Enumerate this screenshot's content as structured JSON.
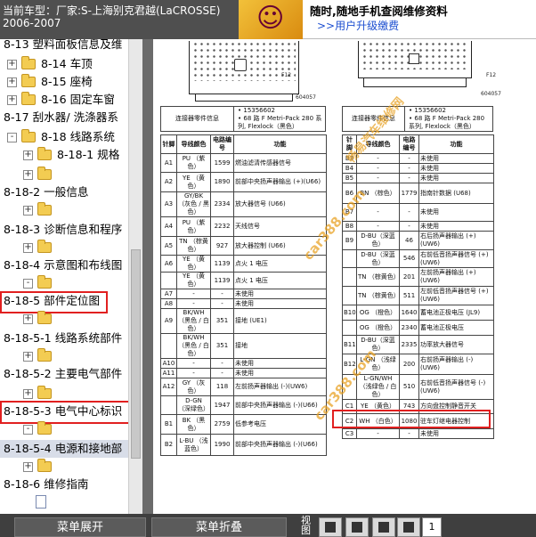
{
  "header": {
    "line1": "当前车型：厂家:S-上海别克君越(LaCROSSE)",
    "line2": "2006-2007"
  },
  "banner": {
    "line1": "随时,随地手机查阅维修资料",
    "line2": ">>用户升级缴费"
  },
  "tree": {
    "items": [
      {
        "label": "8-13 塑料面板信息及维",
        "expander": "",
        "icon": "none"
      },
      {
        "label": "8-14 车顶",
        "expander": "+",
        "icon": "folder"
      },
      {
        "label": "8-15 座椅",
        "expander": "+",
        "icon": "folder"
      },
      {
        "label": "8-16 固定车窗",
        "expander": "+",
        "icon": "folder"
      },
      {
        "label": "8-17 刮水器/ 洗涤器系",
        "expander": "",
        "icon": "none"
      },
      {
        "label": "8-18 线路系统",
        "expander": "-",
        "icon": "folder"
      },
      {
        "label": "8-18-1 规格",
        "expander": "+",
        "icon": "folder"
      },
      {
        "label": "",
        "expander": "+",
        "icon": "folder"
      },
      {
        "label": "8-18-2 一般信息",
        "expander": "",
        "icon": "none"
      },
      {
        "label": "",
        "expander": "+",
        "icon": "folder"
      },
      {
        "label": "8-18-3 诊断信息和程序",
        "expander": "",
        "icon": "none"
      },
      {
        "label": "",
        "expander": "+",
        "icon": "folder"
      },
      {
        "label": "8-18-4 示意图和布线图",
        "expander": "",
        "icon": "none"
      },
      {
        "label": "",
        "expander": "-",
        "icon": "folder"
      },
      {
        "label": "8-18-5 部件定位图",
        "expander": "",
        "icon": "none"
      },
      {
        "label": "",
        "expander": "+",
        "icon": "folder"
      },
      {
        "label": "8-18-5-1 线路系统部件",
        "expander": "",
        "icon": "none"
      },
      {
        "label": "",
        "expander": "+",
        "icon": "folder"
      },
      {
        "label": "8-18-5-2 主要电气部件",
        "expander": "",
        "icon": "none"
      },
      {
        "label": "",
        "expander": "+",
        "icon": "folder"
      },
      {
        "label": "8-18-5-3 电气中心标识",
        "expander": "",
        "icon": "none"
      },
      {
        "label": "",
        "expander": "-",
        "icon": "folder"
      },
      {
        "label": "8-18-5-4 电源和接地部",
        "expander": "",
        "icon": "none"
      },
      {
        "label": "",
        "expander": "+",
        "icon": "folder"
      },
      {
        "label": "8-18-6 维修指南",
        "expander": "",
        "icon": "none"
      },
      {
        "label": "",
        "expander": "",
        "icon": "doc"
      }
    ]
  },
  "document": {
    "left_connector": {
      "label": "F12",
      "code": "604057"
    },
    "right_connector": {
      "label": "F12",
      "code": "604057"
    },
    "left_info": {
      "title": "连接器零件信息",
      "lines": [
        "15356602",
        "68 路 F Metri-Pack 280 系列, Flexlock（黑色）"
      ]
    },
    "right_info": {
      "title": "连接器零件信息",
      "lines": [
        "15356602",
        "68 路 F Metri-Pack 280 系列, Flexlock（黑色）"
      ]
    },
    "left_table": {
      "headers": [
        "针脚",
        "导线颜色",
        "电路编号",
        "功能"
      ],
      "rows": [
        [
          "A1",
          "PU （紫色）",
          "1599",
          "燃油滤清传感器信号"
        ],
        [
          "A2",
          "YE （黄色）",
          "1890",
          "前部中央扬声器输出 (+)(U66)"
        ],
        [
          "A3",
          "GY/BK（灰色 / 黑色）",
          "2334",
          "放大器信号 (U66)"
        ],
        [
          "A4",
          "PU （紫色）",
          "2232",
          "天线信号"
        ],
        [
          "A5",
          "TN （棕黄色）",
          "927",
          "放大器控制 (U66)"
        ],
        [
          "A6",
          "YE （黄色）",
          "1139",
          "点火 1 电压"
        ],
        [
          "",
          "YE （黄色）",
          "1139",
          "点火 1 电压"
        ],
        [
          "A7",
          "-",
          "-",
          "未使用"
        ],
        [
          "A8",
          "-",
          "-",
          "未使用"
        ],
        [
          "A9",
          "BK/WH（黑色 / 白色）",
          "351",
          "接地 (UE1)"
        ],
        [
          "",
          "BK/WH（黑色 / 白色）",
          "351",
          "接地"
        ],
        [
          "A10",
          "-",
          "-",
          "未使用"
        ],
        [
          "A11",
          "-",
          "-",
          "未使用"
        ],
        [
          "A12",
          "GY （灰色）",
          "118",
          "左前扬声器输出 (-)(UW6)"
        ],
        [
          "",
          "D-GN （深绿色）",
          "1947",
          "前部中央扬声器输出 (-)(U66)"
        ],
        [
          "B1",
          "BK （黑色）",
          "2759",
          "低参考电压"
        ],
        [
          "B2",
          "L-BU （浅蓝色）",
          "1990",
          "前部中央扬声器输出 (-)(U66)"
        ]
      ]
    },
    "right_table": {
      "headers": [
        "针脚",
        "导线颜色",
        "电路编号",
        "功能"
      ],
      "rows": [
        [
          "B3",
          "-",
          "-",
          "未使用"
        ],
        [
          "B4",
          "-",
          "-",
          "未使用"
        ],
        [
          "B5",
          "-",
          "-",
          "未使用"
        ],
        [
          "B6",
          "BN （棕色）",
          "1779",
          "指南针数据 (U68)"
        ],
        [
          "B7",
          "-",
          "-",
          "未使用"
        ],
        [
          "B8",
          "-",
          "-",
          "未使用"
        ],
        [
          "B9",
          "D-BU（深蓝色）",
          "46",
          "右后扬声器输出 (+)(UW6)"
        ],
        [
          "",
          "D-BU（深蓝色）",
          "546",
          "右前低音扬声器信号 (+)(UW6)"
        ],
        [
          "",
          "TN （棕黄色）",
          "201",
          "左前扬声器输出 (+)(UW6)"
        ],
        [
          "",
          "TN （棕黄色）",
          "511",
          "左前低音扬声器信号 (+)(UW6)"
        ],
        [
          "B10",
          "OG （橙色）",
          "1640",
          "蓄电池正极电压 (JL9)"
        ],
        [
          "",
          "OG （橙色）",
          "2340",
          "蓄电池正极电压"
        ],
        [
          "B11",
          "D-BU（深蓝色）",
          "2335",
          "功率放大器信号"
        ],
        [
          "B12",
          "L-GN （浅绿色）",
          "200",
          "右前扬声器输出 (-)(UW6)"
        ],
        [
          "",
          "L-GN/WH（浅绿色 / 白色）",
          "510",
          "右前低音扬声器信号 (-)(UW6)"
        ],
        [
          "C1",
          "YE （黄色）",
          "743",
          "方向盘控制静音开关"
        ],
        [
          "C2",
          "WH （白色）",
          "1080",
          "驻车灯继电器控制"
        ],
        [
          "C3",
          "-",
          "-",
          "未使用"
        ]
      ]
    },
    "watermarks": [
      "畅易汽车维修网",
      "car388.com",
      "car388.com"
    ]
  },
  "toolbar": {
    "expand_label": "菜单展开",
    "collapse_label": "菜单折叠",
    "view_label": "视图",
    "page_label": "1"
  }
}
